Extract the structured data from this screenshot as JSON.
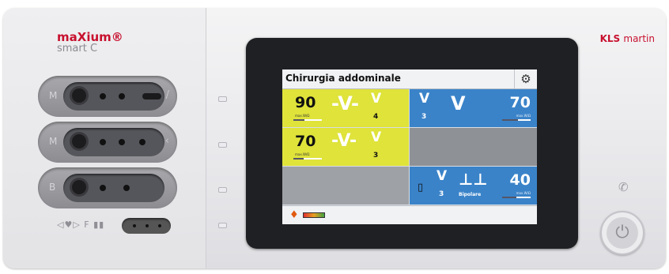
{
  "device": {
    "model": "maXium®",
    "model_sub": "smart C",
    "brand_kls": "KLS",
    "brand_martin": "martin"
  },
  "sockets": [
    {
      "label": "M",
      "icon": "/"
    },
    {
      "label": "M",
      "icon": "‹"
    },
    {
      "label": "B",
      "icon": ""
    }
  ],
  "bottom_icons": "◁♥▷ F ▮▮",
  "screen": {
    "title": "Chirurgia addominale",
    "channels": [
      {
        "power": "90",
        "max_label": "max.W/Ω",
        "mode": "4",
        "level": 0.4,
        "color": "#dfe33a"
      },
      {
        "power": "70",
        "max_label": "max.W/Ω",
        "mode": "3",
        "level": 0.55,
        "color": "#3a83c9"
      },
      {
        "power": "70",
        "max_label": "max.W/Ω",
        "mode": "3",
        "level": 0.35,
        "color": "#dfe33a"
      },
      {
        "power": "40",
        "max_label": "max.W/Ω",
        "mode": "3",
        "sub_label": "Bipolare",
        "level": 0.5,
        "color": "#3a83c9"
      }
    ]
  },
  "icons": {
    "gear": "⚙",
    "standby": "✆",
    "power": "⏻",
    "status_left": "♦"
  }
}
